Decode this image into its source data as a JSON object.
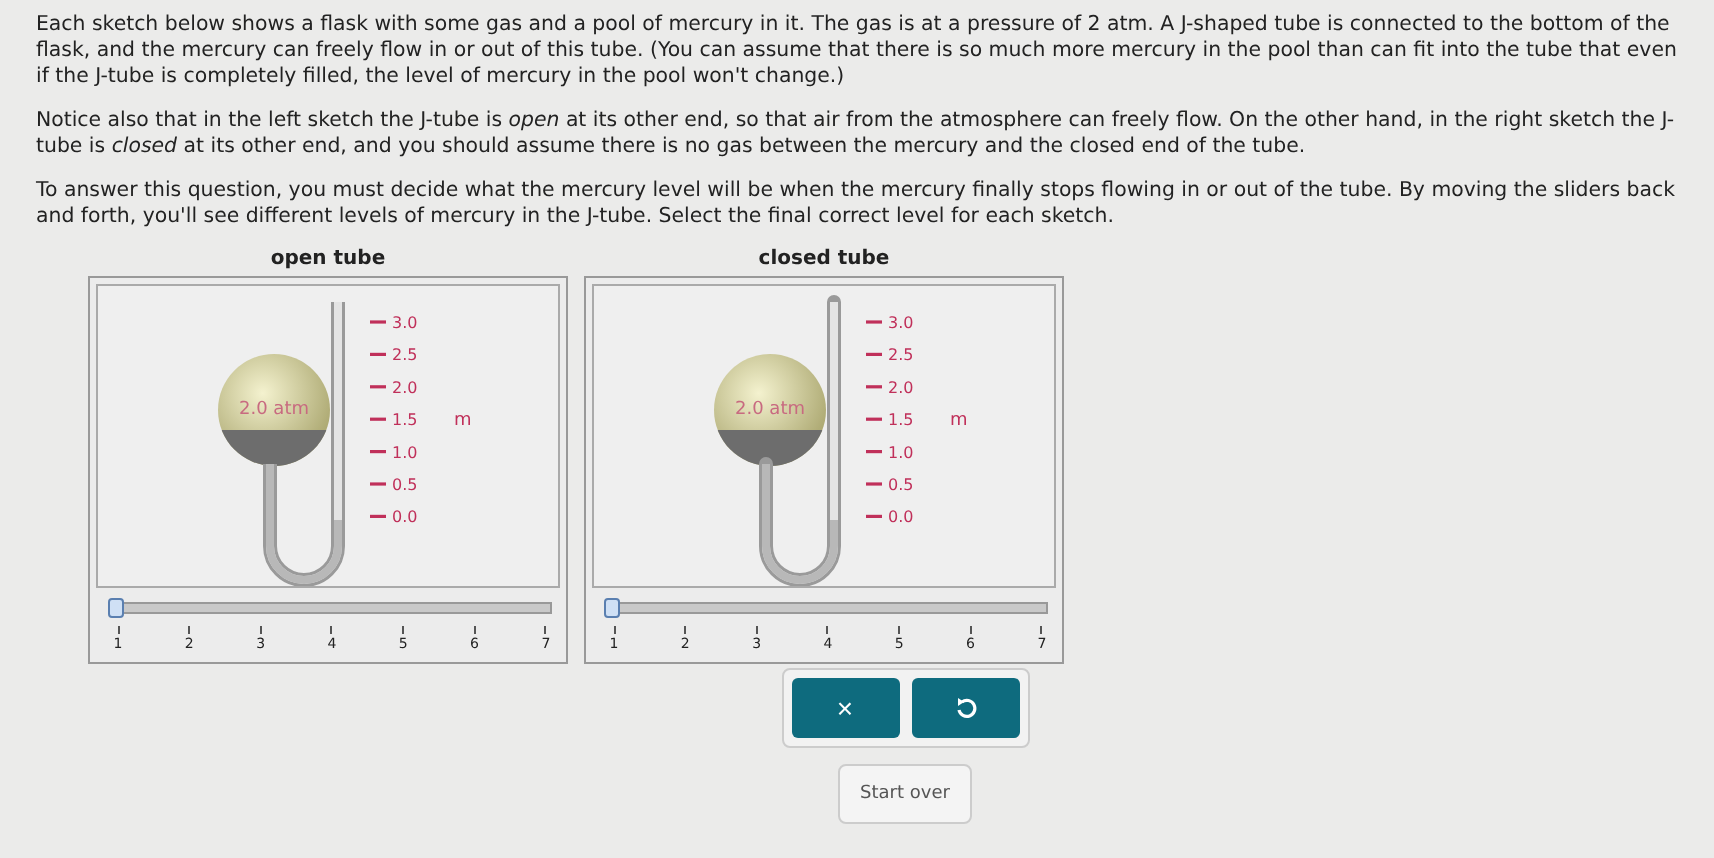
{
  "paragraphs": [
    "Each sketch below shows a flask with some gas and a pool of mercury in it. The gas is at a pressure of 2 atm. A J-shaped tube is connected to the bottom of the flask, and the mercury can freely flow in or out of this tube. (You can assume that there is so much more mercury in the pool than can fit into the tube that even if the J-tube is completely filled, the level of mercury in the pool won't change.)",
    "Notice also that in the left sketch the J-tube is *open* at its other end, so that air from the atmosphere can freely flow. On the other hand, in the right sketch the J-tube is *closed* at its other end, and you should assume there is no gas between the mercury and the closed end of the tube.",
    "To answer this question, you must decide what the mercury level will be when the mercury finally stops flowing in or out of the tube. By moving the sliders back and forth, you'll see different levels of mercury in the J-tube. Select the final correct level for each sketch."
  ],
  "sketches": [
    {
      "title": "open tube",
      "kind": "open",
      "pressure": "2.0 atm",
      "scale": [
        "3.0",
        "2.5",
        "2.0",
        "1.5",
        "1.0",
        "0.5",
        "0.0"
      ],
      "unit": "m",
      "slider": {
        "level": 0,
        "ticks": [
          "1",
          "2",
          "3",
          "4",
          "5",
          "6",
          "7"
        ]
      }
    },
    {
      "title": "closed tube",
      "kind": "closed",
      "pressure": "2.0 atm",
      "scale": [
        "3.0",
        "2.5",
        "2.0",
        "1.5",
        "1.0",
        "0.5",
        "0.0"
      ],
      "unit": "m",
      "slider": {
        "level": 0,
        "ticks": [
          "1",
          "2",
          "3",
          "4",
          "5",
          "6",
          "7"
        ]
      }
    }
  ],
  "buttons": [
    {
      "kind": "clear",
      "label": "×"
    },
    {
      "kind": "undo"
    }
  ],
  "tooltip": "Start over"
}
